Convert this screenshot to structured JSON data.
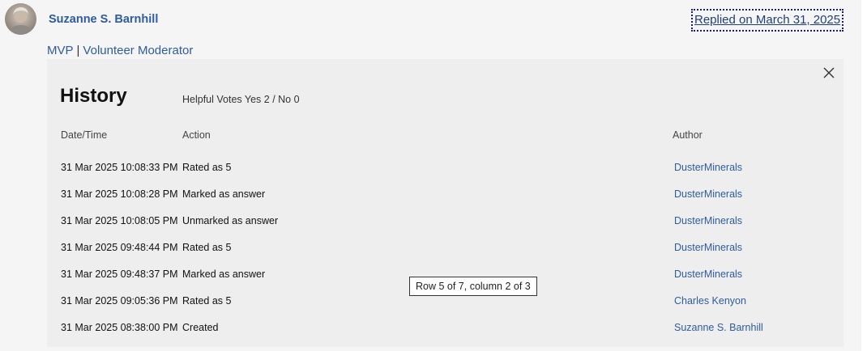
{
  "post": {
    "author_name": "Suzanne S. Barnhill",
    "replied": "Replied on March 31, 2025",
    "roles": [
      "MVP",
      "Volunteer Moderator"
    ],
    "role_separator": "|"
  },
  "history": {
    "title": "History",
    "votes": "Helpful Votes Yes 2 / No 0",
    "columns": [
      "Date/Time",
      "Action",
      "Author"
    ],
    "rows": [
      {
        "datetime": "31 Mar 2025 10:08:33 PM",
        "action": "Rated as 5",
        "author": "DusterMinerals"
      },
      {
        "datetime": "31 Mar 2025 10:08:28 PM",
        "action": "Marked as answer",
        "author": "DusterMinerals"
      },
      {
        "datetime": "31 Mar 2025 10:08:05 PM",
        "action": "Unmarked as answer",
        "author": "DusterMinerals"
      },
      {
        "datetime": "31 Mar 2025 09:48:44 PM",
        "action": "Rated as 5",
        "author": "DusterMinerals"
      },
      {
        "datetime": "31 Mar 2025 09:48:37 PM",
        "action": "Marked as answer",
        "author": "DusterMinerals"
      },
      {
        "datetime": "31 Mar 2025 09:05:36 PM",
        "action": "Rated as 5",
        "author": "Charles Kenyon"
      },
      {
        "datetime": "31 Mar 2025 08:38:00 PM",
        "action": "Created",
        "author": "Suzanne S. Barnhill"
      }
    ],
    "close_icon": "close-icon"
  },
  "tooltip": "Row 5 of 7, column 2 of 3",
  "colors": {
    "link": "#2e5c9e",
    "panel_bg": "#eeeeee",
    "focus_outline": "#1a1a8c"
  }
}
